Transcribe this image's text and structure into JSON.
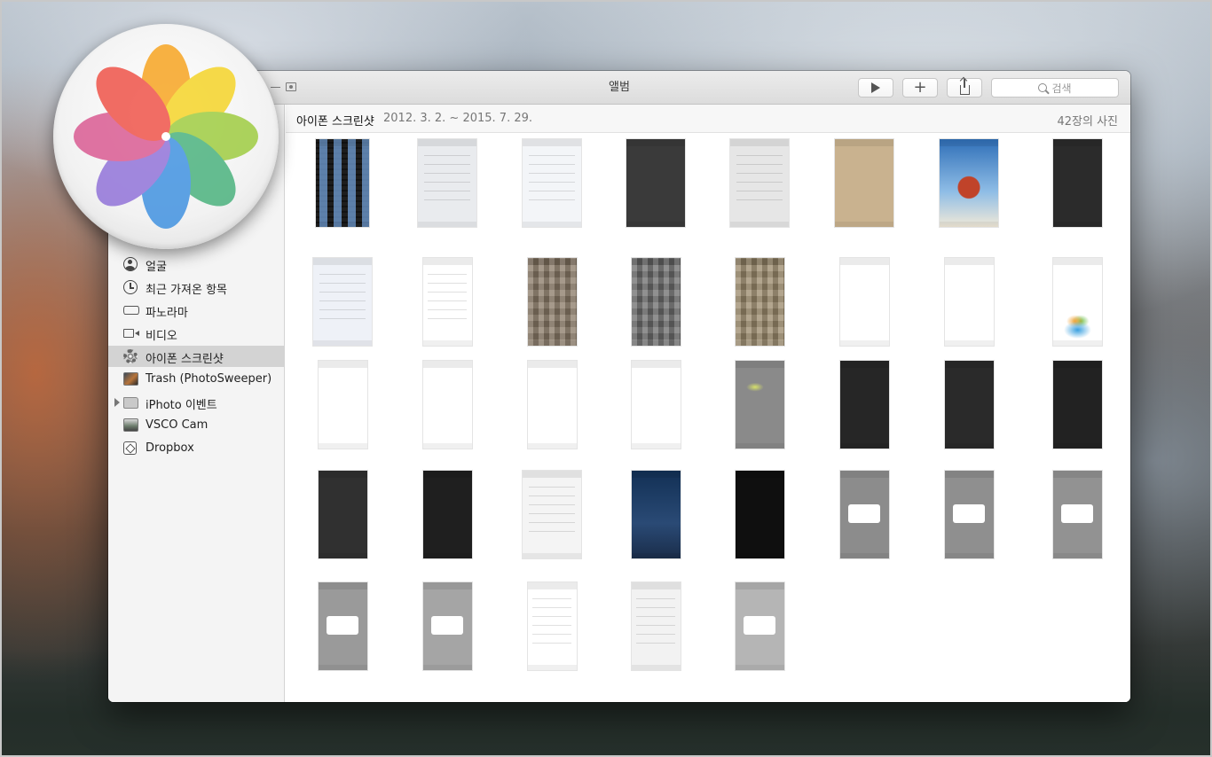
{
  "window": {
    "title": "앨범",
    "search_placeholder": "검색",
    "accent": "#d3d3d3"
  },
  "toolbar": {
    "play_icon": "play-icon",
    "add_icon": "plus-icon",
    "share_icon": "share-icon",
    "search_icon": "magnifier-icon"
  },
  "sidebar": {
    "items": [
      {
        "label": "얼굴",
        "icon": "face-icon",
        "selected": false
      },
      {
        "label": "최근 가져온 항목",
        "icon": "clock-icon",
        "selected": false
      },
      {
        "label": "파노라마",
        "icon": "panorama-icon",
        "selected": false
      },
      {
        "label": "비디오",
        "icon": "video-icon",
        "selected": false
      },
      {
        "label": "아이폰 스크린샷",
        "icon": "gear-icon",
        "selected": true
      },
      {
        "label": "Trash (PhotoSweeper)",
        "icon": "album-thumbnail-icon",
        "selected": false
      },
      {
        "label": "iPhoto 이벤트",
        "icon": "folder-icon",
        "selected": false
      },
      {
        "label": "VSCO Cam",
        "icon": "album-thumbnail-icon",
        "selected": false
      },
      {
        "label": "Dropbox",
        "icon": "dropbox-icon",
        "selected": false
      }
    ]
  },
  "moment": {
    "title": "아이폰 스크린샷",
    "date_range": "2012. 3. 2. ~ 2015. 7. 29.",
    "count": "42장의 사진"
  },
  "grid": {
    "columns": 8,
    "photos": [
      {
        "style": "ios6home",
        "bg": "#1d1d1d"
      },
      {
        "style": "bump",
        "bg": "#e9ebee"
      },
      {
        "style": "webpage",
        "bg": "#f3f5f8"
      },
      {
        "style": "photo",
        "bg": "#3a3a3a"
      },
      {
        "style": "share",
        "bg": "#e6e6e6"
      },
      {
        "style": "photo",
        "bg": "#c9b28f"
      },
      {
        "style": "sky",
        "bg": "#3d83c8"
      },
      {
        "style": "dark",
        "bg": "#2b2b2b"
      },
      {
        "style": "webpage",
        "bg": "#eef1f7"
      },
      {
        "style": "list",
        "bg": "#ffffff"
      },
      {
        "style": "mosaic",
        "bg": "#8a7a68"
      },
      {
        "style": "mosaic",
        "bg": "#6e6e6e"
      },
      {
        "style": "mosaic",
        "bg": "#9c8a6c"
      },
      {
        "style": "blank",
        "bg": "#ffffff"
      },
      {
        "style": "blank",
        "bg": "#ffffff"
      },
      {
        "style": "sprout",
        "bg": "#ffffff"
      },
      {
        "style": "blank",
        "bg": "#ffffff"
      },
      {
        "style": "blank",
        "bg": "#ffffff"
      },
      {
        "style": "blank",
        "bg": "#ffffff"
      },
      {
        "style": "blank",
        "bg": "#ffffff"
      },
      {
        "style": "mindmap",
        "bg": "#8a8a8a"
      },
      {
        "style": "dark",
        "bg": "#262626"
      },
      {
        "style": "dark",
        "bg": "#2a2a2a"
      },
      {
        "style": "dark",
        "bg": "#222222"
      },
      {
        "style": "dark",
        "bg": "#303030"
      },
      {
        "style": "darkapp",
        "bg": "#1f1f1f"
      },
      {
        "style": "webpage",
        "bg": "#f4f4f4"
      },
      {
        "style": "night",
        "bg": "#1f3556"
      },
      {
        "style": "dark",
        "bg": "#0f0f0f"
      },
      {
        "style": "alert",
        "bg": "#8c8c8c"
      },
      {
        "style": "alert",
        "bg": "#8f8f8f"
      },
      {
        "style": "alert",
        "bg": "#929292"
      },
      {
        "style": "alert",
        "bg": "#9a9a9a"
      },
      {
        "style": "alert",
        "bg": "#a5a5a5"
      },
      {
        "style": "list",
        "bg": "#ffffff"
      },
      {
        "style": "list",
        "bg": "#f2f2f2"
      },
      {
        "style": "alert",
        "bg": "#b5b5b5"
      }
    ]
  }
}
